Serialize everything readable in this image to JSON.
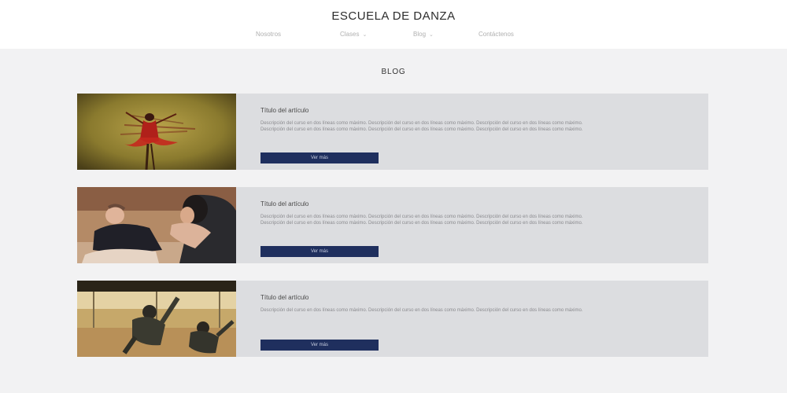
{
  "header": {
    "site_title": "ESCUELA DE DANZA",
    "nav": [
      {
        "label": "Nosotros",
        "has_dropdown": false
      },
      {
        "label": "Clases",
        "has_dropdown": true
      },
      {
        "label": "Blog",
        "has_dropdown": true
      },
      {
        "label": "Contáctenos",
        "has_dropdown": false
      }
    ]
  },
  "blog": {
    "section_title": "BLOG",
    "posts": [
      {
        "image": "dancer-red-dress-photo",
        "title": "Título del artículo",
        "paragraph_1": "Descripción del curso en dos líneas como máximo. Descripción del curso en dos líneas como máximo. Descripción del curso en dos líneas como máximo.",
        "paragraph_2": "Descripción del curso en dos líneas como máximo. Descripción del curso en dos líneas como máximo. Descripción del curso en dos líneas como máximo.",
        "button_label": "Ver más"
      },
      {
        "image": "dance-teacher-stretching-photo",
        "title": "Título del artículo",
        "paragraph_1": "Descripción del curso en dos líneas como máximo. Descripción del curso en dos líneas como máximo. Descripción del curso en dos líneas como máximo.",
        "paragraph_2": "Descripción del curso en dos líneas como máximo. Descripción del curso en dos líneas como máximo. Descripción del curso en dos líneas como máximo.",
        "button_label": "Ver más"
      },
      {
        "image": "breakdance-studio-photo",
        "title": "Título del artículo",
        "paragraph_1": "Descripción del curso en dos líneas como máximo. Descripción del curso en dos líneas como máximo. Descripción del curso en dos líneas como máximo.",
        "paragraph_2": "",
        "button_label": "Ver más"
      }
    ]
  },
  "colors": {
    "page_background": "#f2f2f3",
    "card_background": "#dcdde0",
    "button_background": "#1f2f5e"
  }
}
